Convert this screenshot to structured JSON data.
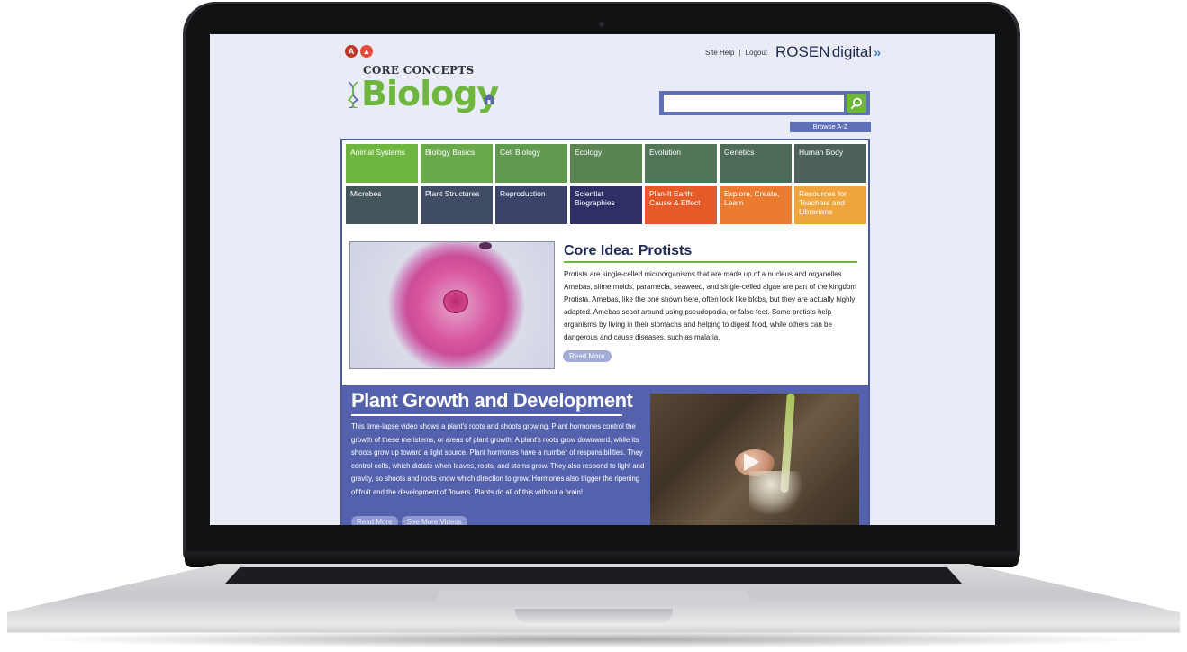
{
  "header": {
    "logo_badges": [
      "A",
      "▲"
    ],
    "core_concepts": "CORE CONCEPTS",
    "biology": "Biology",
    "site_help": "Site Help",
    "separator": "|",
    "logout": "Logout",
    "rosen": "ROSEN",
    "digital": "digital",
    "rosen_arrow": "»"
  },
  "search": {
    "placeholder": "",
    "browse_label": "Browse A-Z"
  },
  "colors": {
    "accent_green": "#6fb63f",
    "primary_blue": "#5462ad",
    "navy": "#1e2a52"
  },
  "nav": {
    "tiles": [
      {
        "label": "Animal Systems",
        "color": "#6fb63f"
      },
      {
        "label": "Biology Basics",
        "color": "#6aa84c"
      },
      {
        "label": "Cell Biology",
        "color": "#5f9a4f"
      },
      {
        "label": "Ecology",
        "color": "#5a8553"
      },
      {
        "label": "Evolution",
        "color": "#517556"
      },
      {
        "label": "Genetics",
        "color": "#4e6a59"
      },
      {
        "label": "Human Body",
        "color": "#4c615a"
      },
      {
        "label": "Microbes",
        "color": "#44555b"
      },
      {
        "label": "Plant Structures",
        "color": "#3f4c63"
      },
      {
        "label": "Reproduction",
        "color": "#3b4468"
      },
      {
        "label": "Scientist Biographies",
        "color": "#2e2f66"
      },
      {
        "label": "Plan-It Earth: Cause & Effect",
        "color": "#e55a27"
      },
      {
        "label": "Explore, Create, Learn",
        "color": "#ea7b2f"
      },
      {
        "label": "Resources for Teachers and Librarians",
        "color": "#f0a43c"
      }
    ]
  },
  "core_idea": {
    "title": "Core Idea: Protists",
    "body": "Protists are single-celled microorganisms that are made up of a nucleus and organelles. Amebas, slime molds, paramecia, seaweed, and single-celled algae are part of the kingdom Protista. Amebas, like the one shown here, often look like blobs, but they are actually highly adapted. Amebas scoot around using pseudopodia, or false feet. Some protists help organisms by living in their stomachs and helping to digest food, while others can be dangerous and cause diseases, such as malaria.",
    "read_more": "Read More"
  },
  "feature": {
    "title": "Plant Growth and Development",
    "body": "This time-lapse video shows a plant's roots and shoots growing. Plant hormones control the growth of these meristems, or areas of plant growth. A plant's roots grow downward, while its shoots grow up toward a light source. Plant hormones have a number of responsibilities. They control cells, which dictate when leaves, roots, and stems grow. They also respond to light and gravity, so shoots and roots know which direction to grow. Hormones also trigger the ripening of fruit and the development of flowers. Plants do all of this without a brain!",
    "read_more": "Read More",
    "see_more_videos": "See More Videos"
  }
}
